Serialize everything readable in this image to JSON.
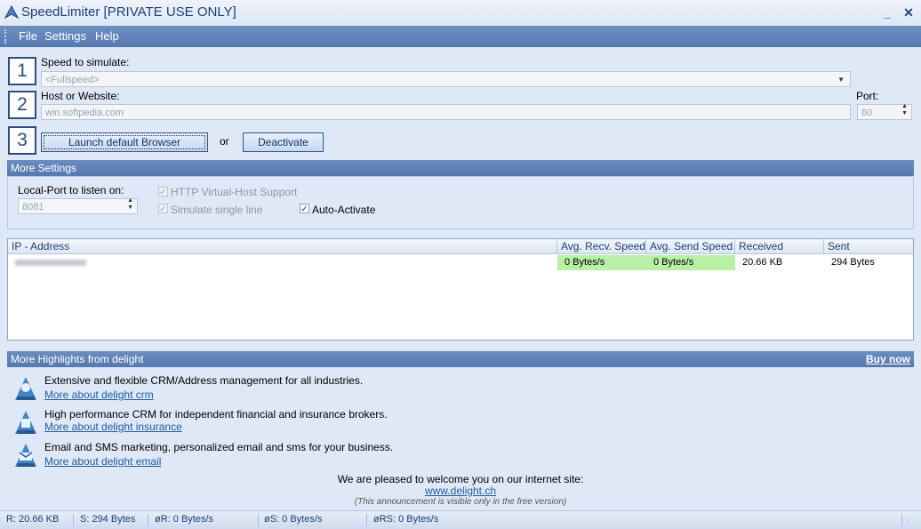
{
  "window": {
    "title": "SpeedLimiter [PRIVATE USE ONLY]",
    "minimize": "_",
    "close": "✕"
  },
  "menu": {
    "file": "File",
    "settings": "Settings",
    "help": "Help"
  },
  "steps": {
    "one": "1",
    "two": "2",
    "three": "3"
  },
  "speed": {
    "label": "Speed to simulate:",
    "value": "<Fullspeed>"
  },
  "host": {
    "label": "Host or Website:",
    "value": "win.softpedia.com",
    "port_label": "Port:",
    "port_value": "80"
  },
  "actions": {
    "launch": "Launch default Browser",
    "or": "or",
    "deactivate": "Deactivate"
  },
  "more_settings": {
    "title": "More Settings",
    "local_port_label": "Local-Port to listen on:",
    "local_port_value": "8081",
    "http_vhost": "HTTP Virtual-Host Support",
    "single_line": "Simulate single line",
    "auto_activate": "Auto-Activate"
  },
  "table": {
    "headers": [
      "IP - Address",
      "Avg. Recv. Speed",
      "Avg. Send Speed",
      "Received",
      "Sent"
    ],
    "rows": [
      {
        "ip": "",
        "recv": "0 Bytes/s",
        "send": "0 Bytes/s",
        "received": "20.66 KB",
        "sent": "294 Bytes"
      }
    ]
  },
  "highlights": {
    "title": "More Highlights from delight",
    "buy": "Buy now",
    "items": [
      {
        "text": "Extensive and flexible CRM/Address management for all industries.",
        "link": "More about delight crm"
      },
      {
        "text": "High performance CRM for independent financial and insurance brokers.",
        "link": "More about delight insurance"
      },
      {
        "text": "Email and SMS marketing, personalized email and sms for your business.",
        "link": "More about delight email"
      }
    ],
    "welcome": "We are pleased to welcome you on our internet site:",
    "site": "www.delight.ch",
    "note": "(This announcement is visible only in the free version)"
  },
  "status": {
    "received": "R: 20.66 KB",
    "sent": "S: 294 Bytes",
    "avg_recv": "øR: 0 Bytes/s",
    "avg_send": "øS: 0 Bytes/s",
    "avg_rs": "øRS: 0 Bytes/s"
  },
  "colors": {
    "accent": "#5579b0",
    "frame": "#dfe8f6",
    "speed_ok": "#b8f0a6"
  }
}
